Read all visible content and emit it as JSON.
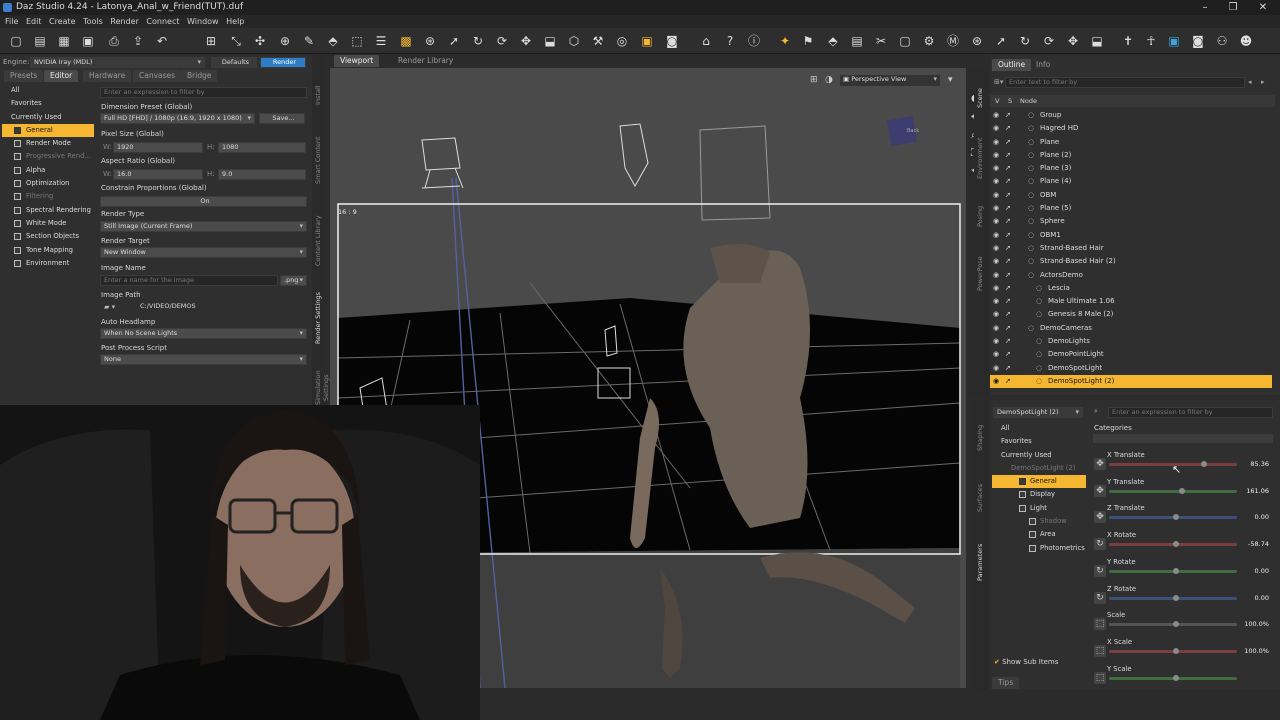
{
  "window": {
    "title": "Daz Studio 4.24 - Latonya_Anal_w_Friend(TUT).duf",
    "controls": [
      "–",
      "❐",
      "✕"
    ]
  },
  "menu": [
    "File",
    "Edit",
    "Create",
    "Tools",
    "Render",
    "Connect",
    "Window",
    "Help"
  ],
  "render_settings": {
    "engine_label": "Engine:",
    "engine_value": "NVIDIA Iray (MDL)",
    "defaults_button": "Defaults",
    "render_button": "Render",
    "tabs": [
      "Presets",
      "Editor",
      "Hardware",
      "Canvases",
      "Bridge"
    ],
    "active_tab": "Editor",
    "categories": [
      "All",
      "Favorites",
      "Currently Used",
      "General",
      "Render Mode",
      "Progressive Rend...",
      "Alpha",
      "Optimization",
      "Filtering",
      "Spectral Rendering",
      "White Mode",
      "Section Objects",
      "Tone Mapping",
      "Environment"
    ],
    "selected_category": "General",
    "filter_placeholder": "Enter an expression to filter by",
    "dimension_preset_label": "Dimension Preset (Global)",
    "dimension_preset_value": "Full HD [FHD] / 1080p (16:9, 1920 x 1080)",
    "save_button": "Save...",
    "pixel_size_label": "Pixel Size (Global)",
    "w_label": "W:",
    "w_value": "1920",
    "h_label": "H:",
    "h_value": "1080",
    "aspect_ratio_label": "Aspect Ratio (Global)",
    "aspect_w": "16.0",
    "aspect_h": "9.0",
    "constrain_label": "Constrain Proportions (Global)",
    "constrain_value": "On",
    "render_type_label": "Render Type",
    "render_type_value": "Still Image (Current Frame)",
    "render_target_label": "Render Target",
    "render_target_value": "New Window",
    "image_name_label": "Image Name",
    "image_name_placeholder": "Enter a name for the image",
    "image_name_ext": ".png",
    "image_path_label": "Image Path",
    "image_path_value": "C:/VIDEO/DEMOS",
    "auto_headlamp_label": "Auto Headlamp",
    "auto_headlamp_value": "When No Scene Lights",
    "post_process_label": "Post Process Script",
    "post_process_value": "None",
    "side_tabs": [
      "Install",
      "Smart Content",
      "Content Library",
      "Render Settings",
      "Simulation Settings"
    ]
  },
  "viewport": {
    "tabs": [
      "Viewport",
      "Render Library"
    ],
    "camera": "Perspective View",
    "aspect_label": "16 : 9",
    "cube_label": "Back"
  },
  "scene": {
    "tabs": [
      "Outline",
      "Info"
    ],
    "filter_placeholder": "Enter text to filter by",
    "header_v": "V",
    "header_s": "S",
    "header_node": "Node",
    "nodes": [
      "Group",
      "Hagred HD",
      "Plane",
      "Plane (2)",
      "Plane (3)",
      "Plane (4)",
      "OBM",
      "Plane (5)",
      "Sphere",
      "OBM1",
      "Strand-Based Hair",
      "Strand-Based Hair (2)",
      "ActorsDemo",
      "Lescia",
      "Male Ultimate 1.06",
      "Genesis 8 Male (2)",
      "DemoCameras",
      "DemoLights",
      "DemoPointLight",
      "DemoSpotLight",
      "DemoSpotLight (2)"
    ],
    "selected": "DemoSpotLight (2)",
    "side_tabs": [
      "Scene",
      "Environment",
      "Posing",
      "PowerPose"
    ]
  },
  "parameters": {
    "node": "DemoSpotLight (2)",
    "filter_placeholder": "Enter an expression to filter by",
    "tree": [
      "All",
      "Favorites",
      "Currently Used",
      "DemoSpotLight (2)",
      "General",
      "Display",
      "Light",
      "Shadow",
      "Area",
      "Photometrics"
    ],
    "selected": "General",
    "categories_label": "Categories",
    "show_sub_items": "Show Sub Items",
    "tips_tab": "Tips",
    "side_tabs": [
      "Shaping",
      "Surfaces",
      "Parameters"
    ],
    "items": [
      {
        "name": "X Translate",
        "value": "85.36",
        "pos": 0.72,
        "color": "#7a3f3f"
      },
      {
        "name": "Y Translate",
        "value": "161.06",
        "pos": 0.55,
        "color": "#3f6f3f"
      },
      {
        "name": "Z Translate",
        "value": "0.00",
        "pos": 0.5,
        "color": "#3f4f7a"
      },
      {
        "name": "X Rotate",
        "value": "-58.74",
        "pos": 0.5,
        "color": "#7a3f3f"
      },
      {
        "name": "Y Rotate",
        "value": "0.00",
        "pos": 0.5,
        "color": "#3f6f3f"
      },
      {
        "name": "Z Rotate",
        "value": "0.00",
        "pos": 0.5,
        "color": "#3f4f7a"
      },
      {
        "name": "Scale",
        "value": "100.0%",
        "pos": 0.5,
        "color": "#555555"
      },
      {
        "name": "X Scale",
        "value": "100.0%",
        "pos": 0.5,
        "color": "#7a3f3f"
      },
      {
        "name": "Y Scale",
        "value": "",
        "pos": 0.5,
        "color": "#3f6f3f"
      }
    ]
  }
}
